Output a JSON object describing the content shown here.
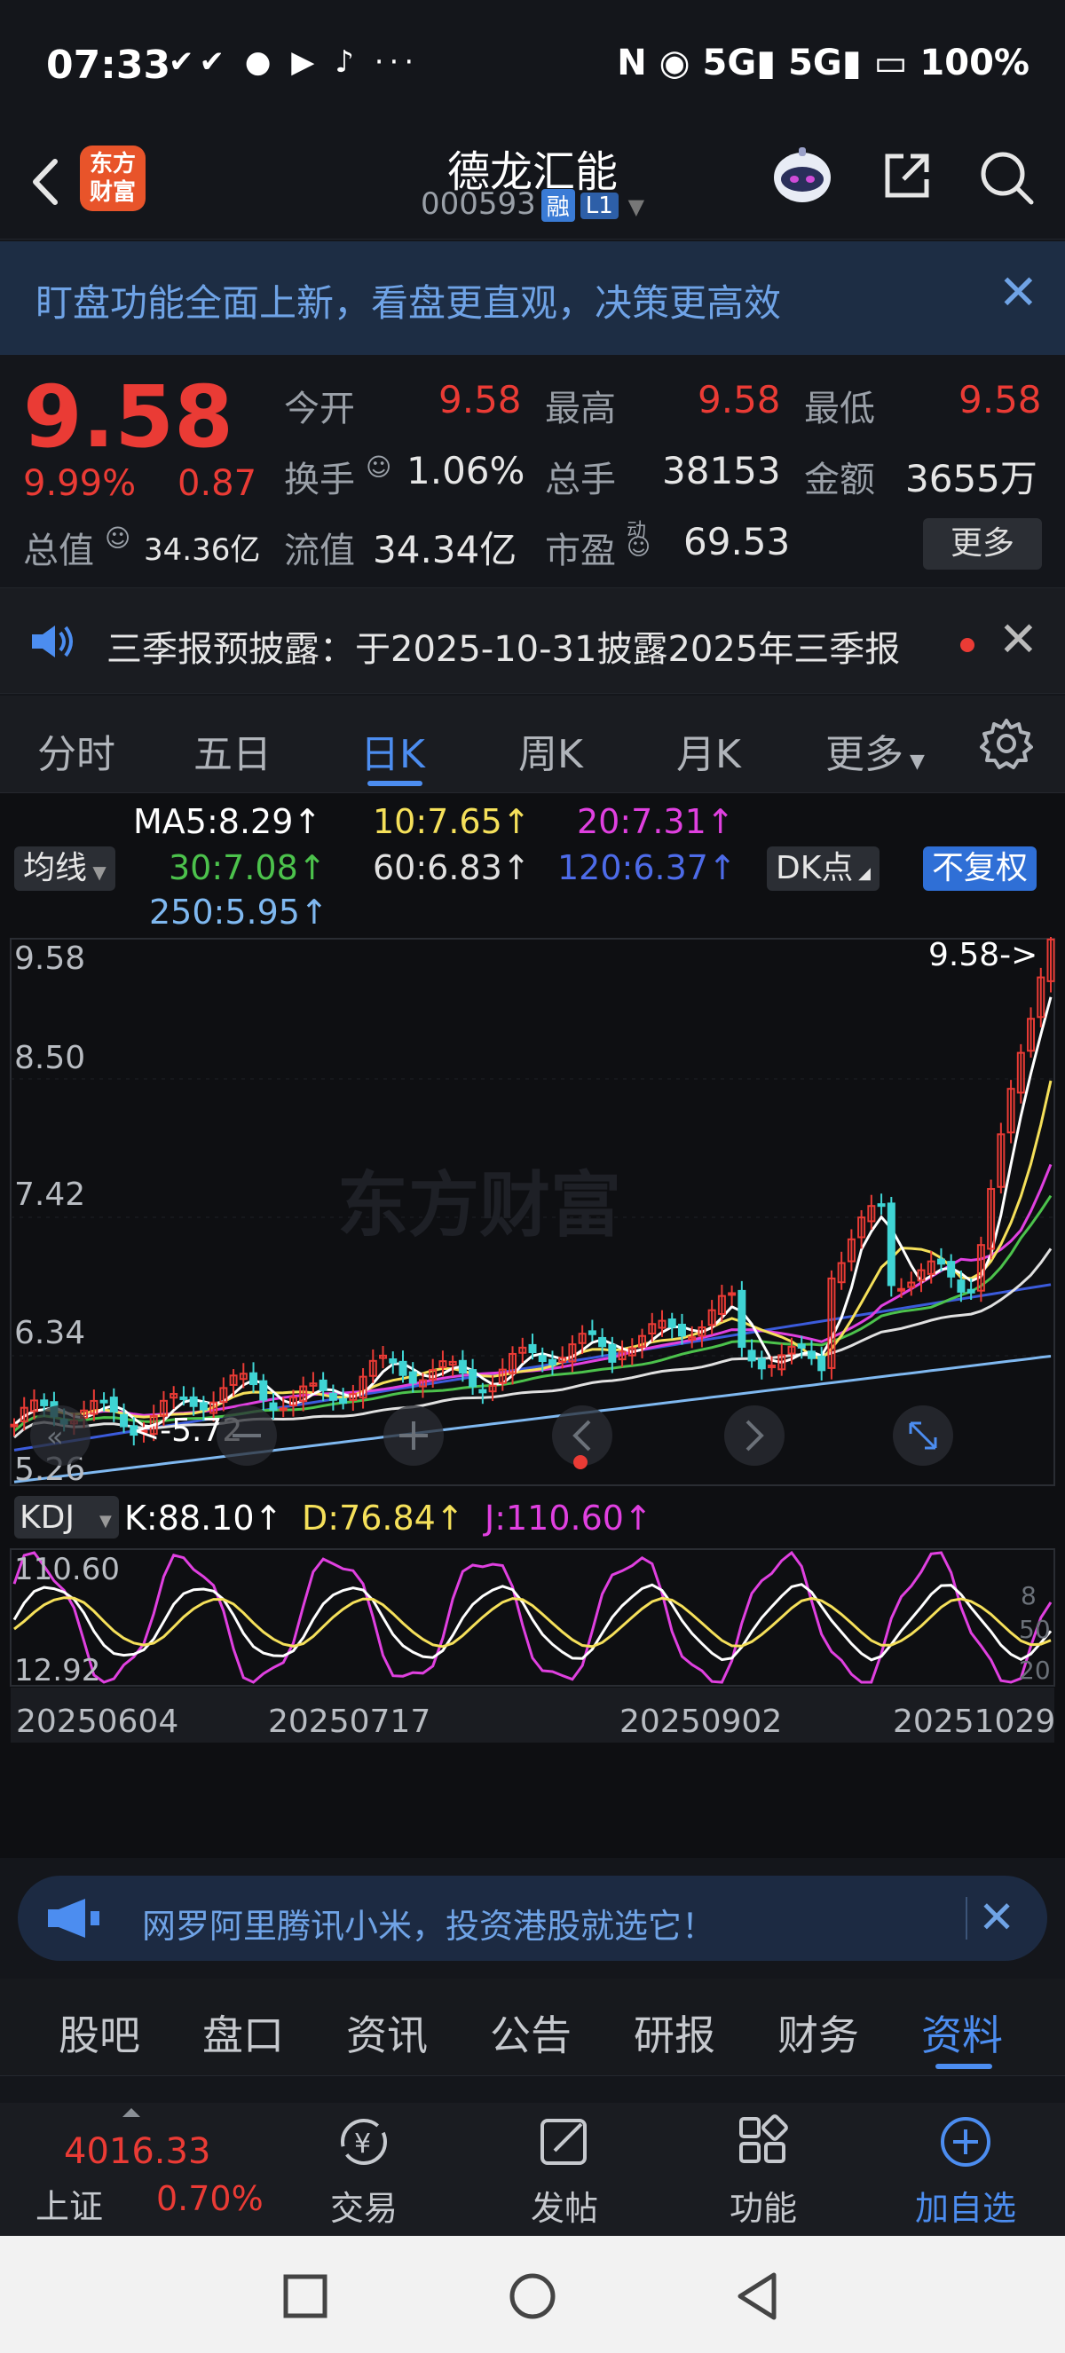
{
  "status_bar": {
    "time": "07:33",
    "icons_left": "✔✔ ● ▶ ♪ ···",
    "right": "N ◉ 5G▮ 5G▮ ▭ 100%"
  },
  "header": {
    "title": "德龙汇能",
    "code": "000593",
    "tag_margin": "融",
    "tag_level": "L1",
    "logo_line1": "东方",
    "logo_line2": "财富"
  },
  "banner": {
    "text": "盯盘功能全面上新，看盘更直观，决策更高效"
  },
  "quote": {
    "price": "9.58",
    "change_pct": "9.99%",
    "change": "0.87",
    "open_label": "今开",
    "open": "9.58",
    "high_label": "最高",
    "high": "9.58",
    "low_label": "最低",
    "low": "9.58",
    "turnover_label": "换手",
    "turnover": "1.06%",
    "volume_label": "总手",
    "volume": "38153",
    "amount_label": "金额",
    "amount": "3655万",
    "mktcap_label": "总值",
    "mktcap": "34.36亿",
    "float_label": "流值",
    "float_cap": "34.34亿",
    "pe_label": "市盈",
    "pe_sup": "动",
    "pe": "69.53",
    "more": "更多"
  },
  "notice": {
    "text": "三季报预披露：于2025-10-31披露2025年三季报"
  },
  "ktabs": [
    "分时",
    "五日",
    "日K",
    "周K",
    "月K",
    "更多"
  ],
  "ma_legend": {
    "selector": "均线",
    "ma5": "MA5:8.29↑",
    "ma10": "10:7.65↑",
    "ma20": "20:7.31↑",
    "ma30": "30:7.08↑",
    "ma60": "60:6.83↑",
    "ma120": "120:6.37↑",
    "ma250": "250:5.95↑",
    "dk": "DK点",
    "adjust": "不复权"
  },
  "colors": {
    "ma5": "#ffffff",
    "ma10": "#f5e05a",
    "ma20": "#e040e0",
    "ma30": "#4cc24c",
    "ma60": "#e0e0e0",
    "ma120": "#3b5bdb",
    "ma250": "#7fb8f0",
    "up": "#ea3b35",
    "down": "#3fd4d4"
  },
  "chart_data": {
    "type": "candlestick",
    "price_axis": [
      "9.58",
      "8.50",
      "7.42",
      "6.34",
      "5.26"
    ],
    "ylim": [
      5.26,
      9.58
    ],
    "last_price_label": "9.58->",
    "min_label": "<-5.72",
    "watermark": "东方财富",
    "dates": [
      "20250604",
      "20250717",
      "20250902",
      "20251029"
    ],
    "kdj": {
      "selector": "KDJ",
      "k": "K:88.10↑",
      "d": "D:76.84↑",
      "j": "J:110.60↑",
      "axis_top": "110.60",
      "axis_bottom": "12.92",
      "ref_80": "8",
      "ref_50": "50",
      "ref_20": "20"
    }
  },
  "ad": {
    "text": "网罗阿里腾讯小米，投资港股就选它！"
  },
  "bottom_tabs": [
    "股吧",
    "盘口",
    "资讯",
    "公告",
    "研报",
    "财务",
    "资料"
  ],
  "bottom_bar": {
    "index_value": "4016.33",
    "index_name": "上证",
    "index_pct": "0.70%",
    "items": [
      "交易",
      "发帖",
      "功能",
      "加自选"
    ]
  }
}
